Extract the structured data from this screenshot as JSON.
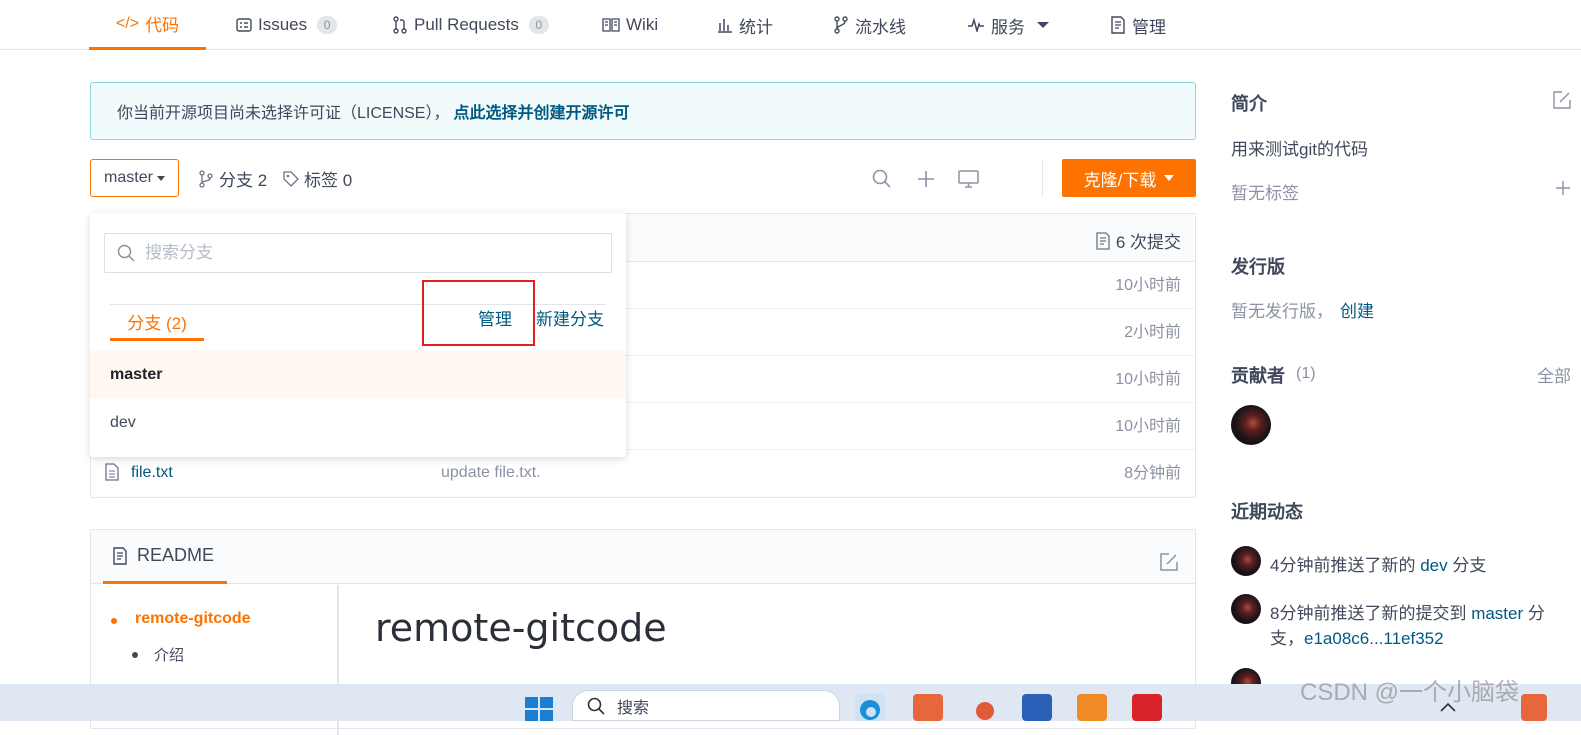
{
  "nav": {
    "tabs": [
      {
        "label": "代码",
        "icon": "code-icon"
      },
      {
        "label": "Issues",
        "count": "0",
        "icon": "issues-icon"
      },
      {
        "label": "Pull Requests",
        "count": "0",
        "icon": "pull-request-icon"
      },
      {
        "label": "Wiki",
        "icon": "book-icon"
      },
      {
        "label": "统计",
        "icon": "bar-chart-icon"
      },
      {
        "label": "流水线",
        "icon": "pipeline-icon"
      },
      {
        "label": "服务",
        "icon": "pulse-icon"
      },
      {
        "label": "管理",
        "icon": "settings-doc-icon"
      }
    ],
    "active": "代码",
    "accent": "#fe7300"
  },
  "notice": {
    "text": "你当前开源项目尚未选择许可证（LICENSE），",
    "link": "点此选择并创建开源许可"
  },
  "toolbar": {
    "branch": "master",
    "branches": "分支 2",
    "tags": "标签 0",
    "clone_label": "克隆/下载"
  },
  "files": {
    "commits": "6 次提交",
    "times": [
      "10小时前",
      "2小时前",
      "10小时前",
      "10小时前"
    ],
    "rows": [
      {
        "name": "file.txt",
        "message": "update file.txt.",
        "time": "8分钟前"
      }
    ]
  },
  "branch_dropdown": {
    "search_placeholder": "搜索分支",
    "tab_label": "分支 (2)",
    "manage_label": "管理",
    "new_branch_label": "新建分支",
    "branches": [
      "master",
      "dev"
    ]
  },
  "readme": {
    "tab_label": "README",
    "toc": [
      "remote-gitcode",
      "介绍"
    ],
    "heading": "remote-gitcode"
  },
  "sidebar": {
    "intro_title": "简介",
    "description": "用来测试git的代码",
    "no_tags": "暂无标签",
    "release_title": "发行版",
    "no_release": "暂无发行版，",
    "create_link": "创建",
    "contributors_title": "贡献者",
    "contributors_count": "(1)",
    "all_link": "全部",
    "activity_title": "近期动态",
    "activities": [
      {
        "prefix": "4分钟前推送了新的 ",
        "link": "dev",
        "suffix": " 分支"
      },
      {
        "prefix": "8分钟前推送了新的提交到 ",
        "link": "master",
        "suffix": " 分支，",
        "line2": "e1a08c6...11ef352"
      }
    ]
  },
  "taskbar": {
    "search_label": "搜索"
  },
  "watermark": "CSDN @一个小脑袋"
}
